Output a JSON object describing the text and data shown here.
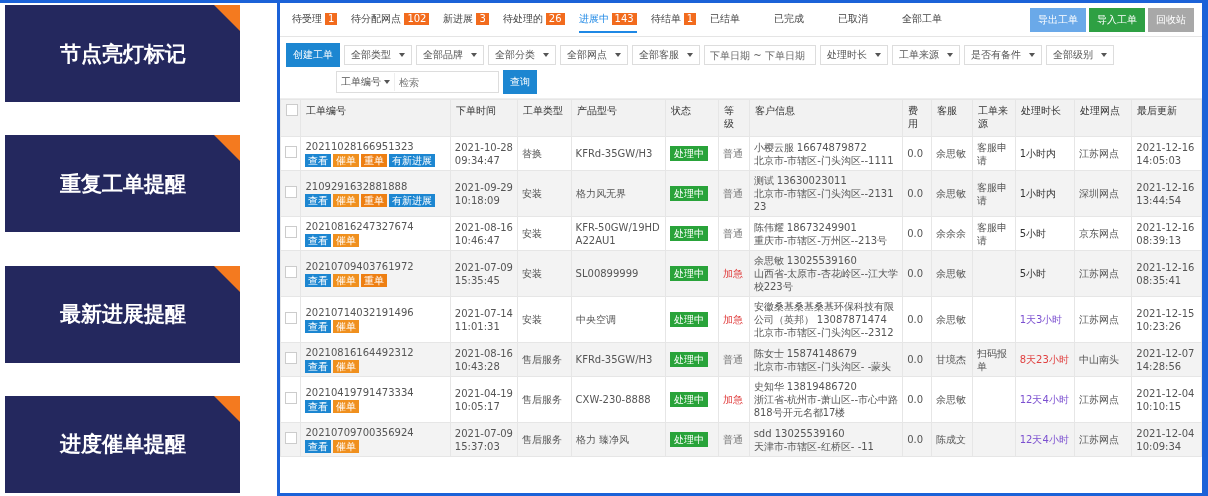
{
  "side_cards": [
    {
      "title": "节点亮灯标记"
    },
    {
      "title": "重复工单提醒"
    },
    {
      "title": "最新进展提醒"
    },
    {
      "title": "进度催单提醒"
    }
  ],
  "tabs": [
    {
      "label": "待受理",
      "badge": "1",
      "selected": false
    },
    {
      "label": "待分配网点",
      "badge": "102",
      "selected": false
    },
    {
      "label": "新进展",
      "badge": "3",
      "selected": false
    },
    {
      "label": "待处理的",
      "badge": "26",
      "selected": false
    },
    {
      "label": "进展中",
      "badge": "143",
      "selected": true
    },
    {
      "label": "待结单",
      "badge": "1",
      "selected": false
    },
    {
      "label": "已结单",
      "selected": false
    },
    {
      "label": "已完成",
      "selected": false
    },
    {
      "label": "已取消",
      "selected": false
    },
    {
      "label": "全部工单",
      "selected": false
    }
  ],
  "actions": [
    {
      "label": "导出工单",
      "kind": "light"
    },
    {
      "label": "导入工单",
      "kind": "green"
    },
    {
      "label": "回收站",
      "kind": "grey"
    }
  ],
  "create_button": "创建工单",
  "filters": [
    {
      "kind": "select",
      "label": "全部类型"
    },
    {
      "kind": "select",
      "label": "全部品牌"
    },
    {
      "kind": "select",
      "label": "全部分类"
    },
    {
      "kind": "select",
      "label": "全部网点"
    },
    {
      "kind": "select",
      "label": "全部客服"
    },
    {
      "kind": "date",
      "placeholder": "下单日期 ~ 下单日期"
    },
    {
      "kind": "select",
      "label": "处理时长"
    },
    {
      "kind": "select",
      "label": "工单来源"
    },
    {
      "kind": "select",
      "label": "是否有备件"
    },
    {
      "kind": "select",
      "label": "全部级别"
    }
  ],
  "search": {
    "field": "工单编号",
    "placeholder": "检索",
    "button": "查询"
  },
  "table": {
    "select_all": false,
    "columns": [
      "工单编号",
      "下单时间",
      "工单类型",
      "产品型号",
      "状态",
      "等级",
      "客户信息",
      "费用",
      "客服",
      "工单来源",
      "处理时长",
      "处理网点",
      "最后更新"
    ],
    "rows": [
      {
        "checked": false,
        "id": "20211028166951323",
        "tags": [
          {
            "label": "查看",
            "kind": "view"
          },
          {
            "label": "催单",
            "kind": "urge"
          },
          {
            "label": "重单",
            "kind": "repeat"
          },
          {
            "label": "有新进展",
            "kind": "progress"
          }
        ],
        "date": "2021-10-28",
        "time": "09:34:47",
        "type": "替换",
        "model": "KFRd-35GW/H3",
        "status": "处理中",
        "level": "普通",
        "urgent": false,
        "customer": [
          "小樱云服 16674879872",
          "北京市-市辖区-门头沟区--1111"
        ],
        "fee": "0.0",
        "agent": "余思敏",
        "source": "客服申请",
        "duration": {
          "text": "1小时内",
          "color": "#333333"
        },
        "site": "江苏网点",
        "updated_date": "2021-12-16",
        "updated_time": "14:05:03"
      },
      {
        "checked": false,
        "id": "2109291632881888",
        "tags": [
          {
            "label": "查看",
            "kind": "view"
          },
          {
            "label": "催单",
            "kind": "urge"
          },
          {
            "label": "重单",
            "kind": "repeat"
          },
          {
            "label": "有新进展",
            "kind": "progress"
          }
        ],
        "date": "2021-09-29",
        "time": "10:18:09",
        "type": "安装",
        "model": "格力风无界",
        "status": "处理中",
        "level": "普通",
        "urgent": false,
        "customer": [
          "测试 13630023011",
          "北京市-市辖区-门头沟区--213123"
        ],
        "fee": "0.0",
        "agent": "余思敏",
        "source": "客服申请",
        "duration": {
          "text": "1小时内",
          "color": "#333333"
        },
        "site": "深圳网点",
        "updated_date": "2021-12-16",
        "updated_time": "13:44:54"
      },
      {
        "checked": false,
        "id": "20210816247327674",
        "tags": [
          {
            "label": "查看",
            "kind": "view"
          },
          {
            "label": "催单",
            "kind": "urge"
          }
        ],
        "date": "2021-08-16",
        "time": "10:46:47",
        "type": "安装",
        "model": "KFR-50GW/19HDA22AU1",
        "status": "处理中",
        "level": "普通",
        "urgent": false,
        "customer": [
          "陈伟耀 18673249901",
          "重庆市-市辖区-万州区--213号"
        ],
        "fee": "0.0",
        "agent": "余余余",
        "source": "客服申请",
        "duration": {
          "text": "5小时",
          "color": "#333333"
        },
        "site": "京东网点",
        "updated_date": "2021-12-16",
        "updated_time": "08:39:13"
      },
      {
        "checked": false,
        "id": "20210709403761972",
        "tags": [
          {
            "label": "查看",
            "kind": "view"
          },
          {
            "label": "催单",
            "kind": "urge"
          },
          {
            "label": "重单",
            "kind": "repeat"
          }
        ],
        "date": "2021-07-09",
        "time": "15:35:45",
        "type": "安装",
        "model": "SL00899999",
        "status": "处理中",
        "level": "加急",
        "urgent": true,
        "customer": [
          "余思敏 13025539160",
          "山西省-太原市-杏花岭区--江大学校223号"
        ],
        "fee": "0.0",
        "agent": "余思敏",
        "source": "",
        "duration": {
          "text": "5小时",
          "color": "#333333"
        },
        "site": "江苏网点",
        "updated_date": "2021-12-16",
        "updated_time": "08:35:41"
      },
      {
        "checked": false,
        "id": "20210714032191496",
        "tags": [
          {
            "label": "查看",
            "kind": "view"
          },
          {
            "label": "催单",
            "kind": "urge"
          }
        ],
        "date": "2021-07-14",
        "time": "11:01:31",
        "type": "安装",
        "model": "中央空调",
        "status": "处理中",
        "level": "加急",
        "urgent": true,
        "customer": [
          "安徽桑基桑基桑基环保科技有限公司（英邦） 13087871474",
          "北京市-市辖区-门头沟区--2312"
        ],
        "fee": "0.0",
        "agent": "余思敏",
        "source": "",
        "duration": {
          "text": "1天3小时",
          "color": "#7b4fd0"
        },
        "site": "江苏网点",
        "updated_date": "2021-12-15",
        "updated_time": "10:23:26"
      },
      {
        "checked": false,
        "id": "20210816164492312",
        "tags": [
          {
            "label": "查看",
            "kind": "view"
          },
          {
            "label": "催单",
            "kind": "urge"
          }
        ],
        "date": "2021-08-16",
        "time": "10:43:28",
        "type": "售后服务",
        "model": "KFRd-35GW/H3",
        "status": "处理中",
        "level": "普通",
        "urgent": false,
        "customer": [
          "陈女士 15874148679",
          "北京市-市辖区-门头沟区- -蒙头"
        ],
        "fee": "0.0",
        "agent": "甘境杰",
        "source": "扫码报单",
        "duration": {
          "text": "8天23小时",
          "color": "#e04040"
        },
        "site": "中山南头",
        "updated_date": "2021-12-07",
        "updated_time": "14:28:56"
      },
      {
        "checked": false,
        "id": "20210419791473334",
        "tags": [
          {
            "label": "查看",
            "kind": "view"
          },
          {
            "label": "催单",
            "kind": "urge"
          }
        ],
        "date": "2021-04-19",
        "time": "10:05:17",
        "type": "售后服务",
        "model": "CXW-230-8888",
        "status": "处理中",
        "level": "加急",
        "urgent": true,
        "customer": [
          "史知华 13819486720",
          "浙江省-杭州市-萧山区--市心中路818号开元名都17楼"
        ],
        "fee": "0.0",
        "agent": "余思敏",
        "source": "",
        "duration": {
          "text": "12天4小时",
          "color": "#7b4fd0"
        },
        "site": "江苏网点",
        "updated_date": "2021-12-04",
        "updated_time": "10:10:15"
      },
      {
        "checked": false,
        "id": "20210709700356924",
        "tags": [
          {
            "label": "查看",
            "kind": "view"
          },
          {
            "label": "催单",
            "kind": "urge"
          }
        ],
        "date": "2021-07-09",
        "time": "15:37:03",
        "type": "售后服务",
        "model": "格力 臻净风",
        "status": "处理中",
        "level": "普通",
        "urgent": false,
        "customer": [
          "sdd 13025539160",
          "天津市-市辖区-红桥区- -11"
        ],
        "fee": "0.0",
        "agent": "陈成文",
        "source": "",
        "duration": {
          "text": "12天4小时",
          "color": "#7b4fd0"
        },
        "site": "江苏网点",
        "updated_date": "2021-12-04",
        "updated_time": "10:09:34"
      }
    ]
  }
}
